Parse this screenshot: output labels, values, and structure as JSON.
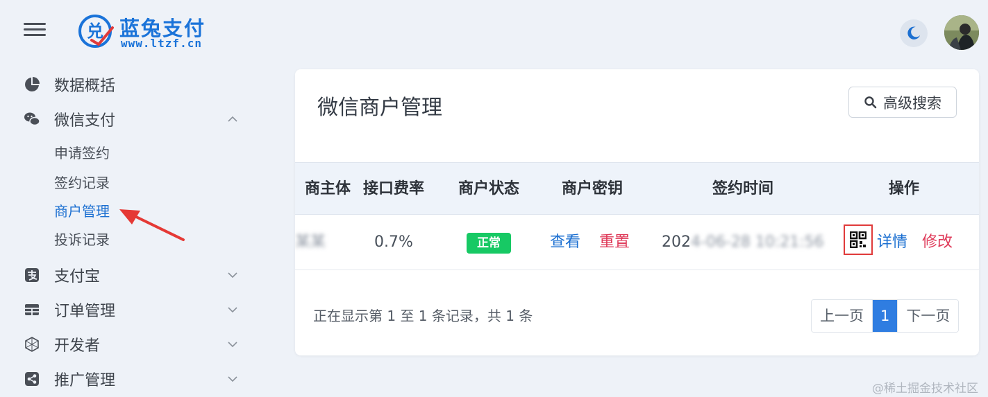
{
  "header": {
    "brand_title": "蓝兔支付",
    "brand_url": "www.ltzf.cn"
  },
  "sidebar": {
    "items": [
      {
        "label": "数据概括",
        "icon": "pie-chart-icon"
      },
      {
        "label": "微信支付",
        "icon": "wechat-icon",
        "expanded": true,
        "children": [
          "申请签约",
          "签约记录",
          "商户管理",
          "投诉记录"
        ],
        "active_child": "商户管理"
      },
      {
        "label": "支付宝",
        "icon": "alipay-icon"
      },
      {
        "label": "订单管理",
        "icon": "table-icon"
      },
      {
        "label": "开发者",
        "icon": "developer-icon"
      },
      {
        "label": "推广管理",
        "icon": "share-icon"
      }
    ]
  },
  "card": {
    "title": "微信商户管理",
    "advanced_search_label": "高级搜索",
    "columns": [
      "商户主体",
      "接口费率",
      "商户状态",
      "商户密钥",
      "签约时间",
      "操作"
    ],
    "visible_first_column_fragment": "商主体",
    "row": {
      "subject": "某某",
      "fee_rate": "0.7%",
      "status": "正常",
      "key_view": "查看",
      "key_reset": "重置",
      "sign_time_prefix": "202",
      "sign_time_rest": "4-06-28 10:21:56",
      "action_detail": "详情",
      "action_edit": "修改"
    },
    "records_info": "正在显示第 1 至 1 条记录，共 1 条",
    "pagination": {
      "prev": "上一页",
      "current": "1",
      "next": "下一页"
    }
  },
  "watermark": "@稀土掘金技术社区",
  "colors": {
    "primary": "#1b6fd1",
    "danger": "#df3a59",
    "success": "#17c964",
    "highlight_box": "#e03a3a"
  }
}
